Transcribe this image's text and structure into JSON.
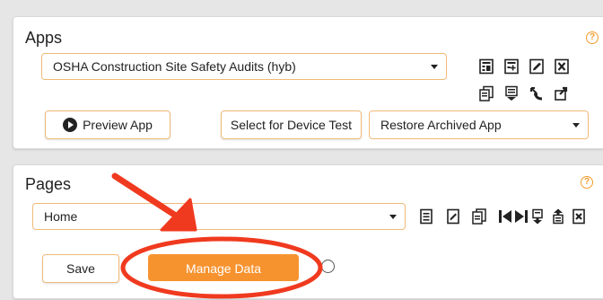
{
  "apps": {
    "title": "Apps",
    "help": "?",
    "selected_app": "OSHA Construction Site Safety Audits (hyb)",
    "preview_label": "Preview App",
    "device_test_label": "Select for Device Test",
    "restore_label": "Restore Archived App",
    "toolbar_icons": [
      "app-properties-icon",
      "add-app-icon",
      "edit-app-icon",
      "delete-app-icon",
      "copy-app-icon",
      "import-icon",
      "move-app-icon",
      "share-app-icon"
    ]
  },
  "pages": {
    "title": "Pages",
    "help": "?",
    "selected_page": "Home",
    "save_label": "Save",
    "manage_data_label": "Manage Data",
    "toolbar_icons": [
      "add-page-icon",
      "edit-page-icon",
      "copy-page-icon",
      "first-page-icon",
      "last-page-icon",
      "move-down-icon",
      "move-up-icon",
      "delete-page-icon"
    ]
  },
  "annotation": {
    "color": "#f03a1f",
    "arrow": "pointing to Manage Data",
    "highlight": "circled Manage Data button"
  },
  "colors": {
    "accent": "#f7932f",
    "border": "#f0b978",
    "annotation": "#f03a1f"
  }
}
